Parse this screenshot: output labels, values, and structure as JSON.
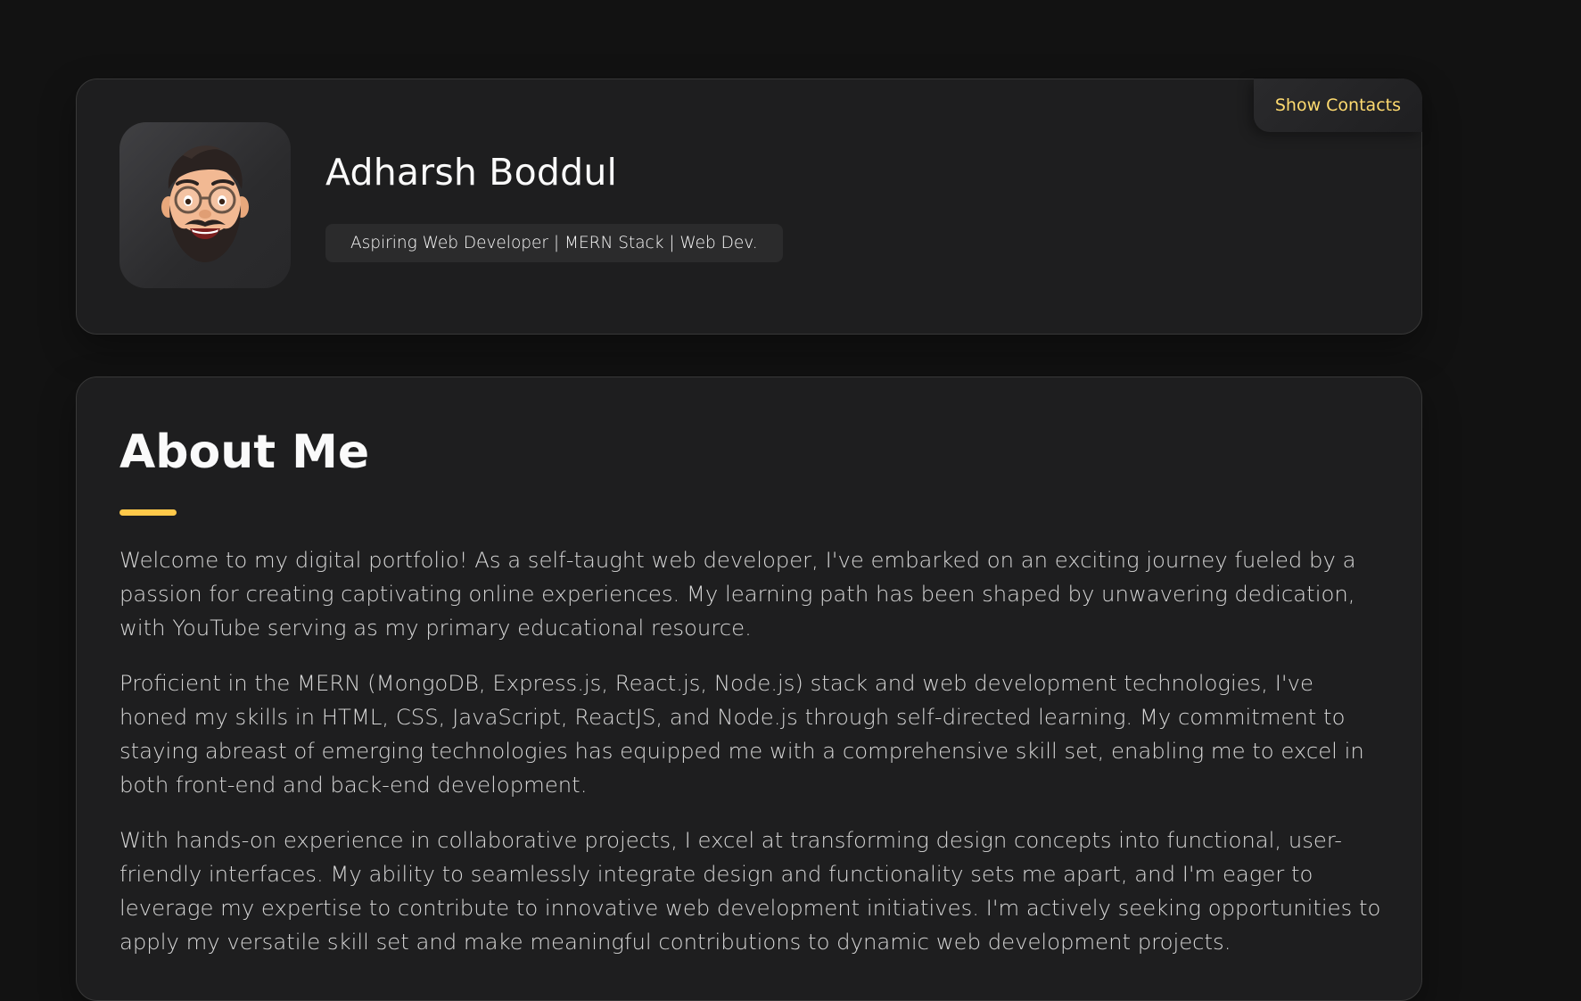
{
  "profile": {
    "name": "Adharsh Boddul",
    "title": "Aspiring Web Developer | MERN Stack | Web Dev.",
    "avatar_icon": "memoji-avatar-icon",
    "show_contacts_label": "Show Contacts"
  },
  "about": {
    "heading": "About Me",
    "paragraphs": [
      "Welcome to my digital portfolio! As a self-taught web developer, I've embarked on an exciting journey fueled by a passion for creating captivating online experiences. My learning path has been shaped by unwavering dedication, with YouTube serving as my primary educational resource.",
      "Proficient in the MERN (MongoDB, Express.js, React.js, Node.js) stack and web development technologies, I've honed my skills in HTML, CSS, JavaScript, ReactJS, and Node.js through self-directed learning. My commitment to staying abreast of emerging technologies has equipped me with a comprehensive skill set, enabling me to excel in both front-end and back-end development.",
      "With hands-on experience in collaborative projects, I excel at transforming design concepts into functional, user-friendly interfaces. My ability to seamlessly integrate design and functionality sets me apart, and I'm eager to leverage my expertise to contribute to innovative web development initiatives. I'm actively seeking opportunities to apply my versatile skill set and make meaningful contributions to dynamic web development projects."
    ]
  },
  "colors": {
    "background": "#121212",
    "card": "#1e1e1f",
    "accent": "#ffdb70",
    "underline": "#ffc94a"
  }
}
